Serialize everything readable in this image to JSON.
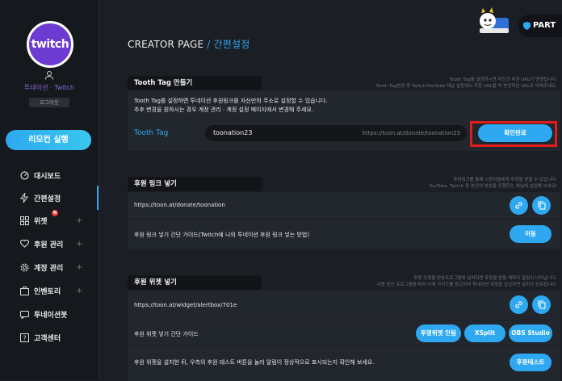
{
  "sidebar": {
    "avatar_text": "twitch",
    "user_name": "투네이션 · Twitch",
    "logout_label": "로그아웃",
    "remote_button": "리모컨 실행",
    "items": [
      {
        "label": "대시보드",
        "icon": "dashboard-icon"
      },
      {
        "label": "간편설정",
        "icon": "lightning-icon"
      },
      {
        "label": "위젯",
        "icon": "widget-icon",
        "badge": "N"
      },
      {
        "label": "후원 관리",
        "icon": "heart-icon"
      },
      {
        "label": "계정 관리",
        "icon": "gear-icon"
      },
      {
        "label": "인벤토리",
        "icon": "inventory-icon"
      },
      {
        "label": "투네이션봇",
        "icon": "bot-icon"
      },
      {
        "label": "고객센터",
        "icon": "support-icon"
      }
    ],
    "plus": "+"
  },
  "header": {
    "title": "CREATOR PAGE",
    "slash": "/",
    "subtitle": "간편설정",
    "partner_label": "PART"
  },
  "tooth_tag": {
    "tab": "Tooth Tag 만들기",
    "note_line1": "Tooth Tag를 설정하시면 자신의 후원 URL이 변경됩니다.",
    "note_line2": "Tooth Tag변경 후 Twitch/YouTube 채널 설정에서 후원 URL을 꼭 변경하신 URL로 바꿔주세요.",
    "desc_line1": "Tooth Tag를 설정하면 투네이션 후원링크를 자신만의 주소로 설정할 수 있습니다.",
    "desc_line2": "추후 변경을 원하시는 경우 계정 관리 · 계정 설정 페이지에서 변경해 주세요.",
    "label": "Tooth Tag",
    "value": "toonation23",
    "hint": "https://toon.at/donate/toonation23",
    "confirm": "확인완료"
  },
  "donate_link": {
    "tab": "후원 링크 넣기",
    "note_line1": "후원링크를 통해 시청자들에게 후원을 받을 수 있습니다.",
    "note_line2": "YouTube, Twitch 등 본인의 방송을 진행하는 채널에 삽입해 보세요!",
    "url": "https://toon.at/donate/toonation",
    "guide": "후원 링크 넣기 간단 가이드(Twitch에 나의 투네이션 후원 링크 넣는 방법)",
    "move": "이동"
  },
  "donate_widget": {
    "tab": "후원 위젯 넣기",
    "note_line1": "후원 위젯을 방송프로그램에 설치하면 후원을 받을 때마다 알림이 나타납니다.",
    "note_line2": "사용 중인 프로그램에 따라 아래 가이드를 참고하여 투네이션 위젯을 삽입하면 설치가 완료됩니다.",
    "url": "https://toon.at/widget/alertbox/701e",
    "guide": "후원 위젯 넣기 간단 가이드",
    "btn_xsplit_guide": "투명위젯 안됨",
    "btn_xsplit": "XSplit",
    "btn_obs": "OBS Studio",
    "test_desc": "후원 위젯을 설치한 뒤, 우측의 후원 테스트 버튼을 눌러 알림이 정상적으로 표시되는지 확인해 보세요.",
    "test_button": "후원테스트"
  },
  "colors": {
    "accent": "#2ea8f0",
    "highlight": "#e21b1b",
    "twitch": "#6c3bd1"
  }
}
